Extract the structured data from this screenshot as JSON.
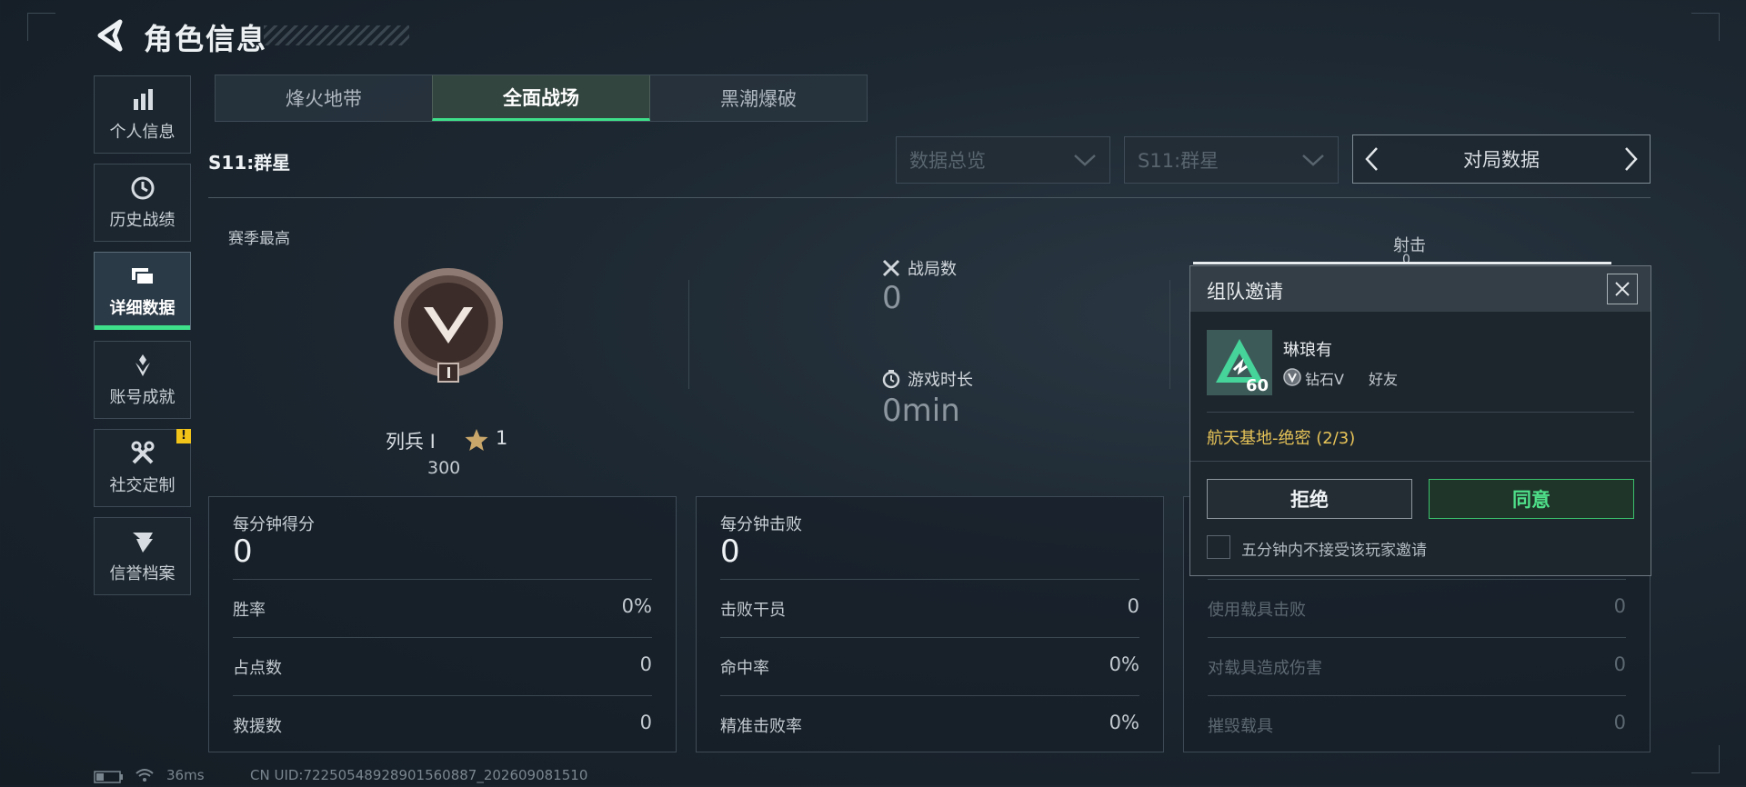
{
  "header": {
    "title": "角色信息"
  },
  "sidebar": {
    "items": [
      {
        "label": "个人信息",
        "icon": "bar-chart-icon"
      },
      {
        "label": "历史战绩",
        "icon": "history-clock-icon"
      },
      {
        "label": "详细数据",
        "icon": "folders-icon",
        "active": true
      },
      {
        "label": "账号成就",
        "icon": "medal-icon"
      },
      {
        "label": "社交定制",
        "icon": "tools-icon",
        "badge": "!"
      },
      {
        "label": "信誉档案",
        "icon": "shield-wing-icon"
      }
    ]
  },
  "tabs": [
    {
      "label": "烽火地带"
    },
    {
      "label": "全面战场",
      "active": true
    },
    {
      "label": "黑潮爆破"
    }
  ],
  "season": {
    "label": "S11:群星"
  },
  "filters": {
    "view": "数据总览",
    "season": "S11:群星",
    "pager_label": "对局数据"
  },
  "season_best": {
    "label": "赛季最高",
    "rank_name": "列兵 I",
    "stars": "1",
    "score": "300"
  },
  "stats": {
    "matches_label": "战局数",
    "matches_value": "0",
    "playtime_label": "游戏时长",
    "playtime_value": "0min",
    "shoot_label": "射击",
    "shoot_value": "0"
  },
  "cards": [
    {
      "title": "每分钟得分",
      "value": "0",
      "rows": [
        {
          "label": "胜率",
          "value": "0%"
        },
        {
          "label": "占点数",
          "value": "0"
        },
        {
          "label": "救援数",
          "value": "0"
        }
      ]
    },
    {
      "title": "每分钟击败",
      "value": "0",
      "rows": [
        {
          "label": "击败干员",
          "value": "0"
        },
        {
          "label": "命中率",
          "value": "0%"
        },
        {
          "label": "精准击败率",
          "value": "0%"
        }
      ]
    },
    {
      "rows": [
        {
          "label": "使用载具击败",
          "value": "0"
        },
        {
          "label": "对载具造成伤害",
          "value": "0"
        },
        {
          "label": "摧毁载具",
          "value": "0"
        }
      ]
    }
  ],
  "invite": {
    "title": "组队邀请",
    "player_name": "琳琅有",
    "avatar_level": "60",
    "rank": "钻石V",
    "relation": "好友",
    "mission": "航天基地-绝密 (2/3)",
    "reject_label": "拒绝",
    "accept_label": "同意",
    "mute_label": "五分钟内不接受该玩家邀请"
  },
  "status_bar": {
    "ping": "36ms",
    "uid": "CN UID:72250548928901560887_202609081510"
  },
  "colors": {
    "accent": "#3ee08a",
    "mission": "#e7c458",
    "warning": "#f2c318"
  }
}
